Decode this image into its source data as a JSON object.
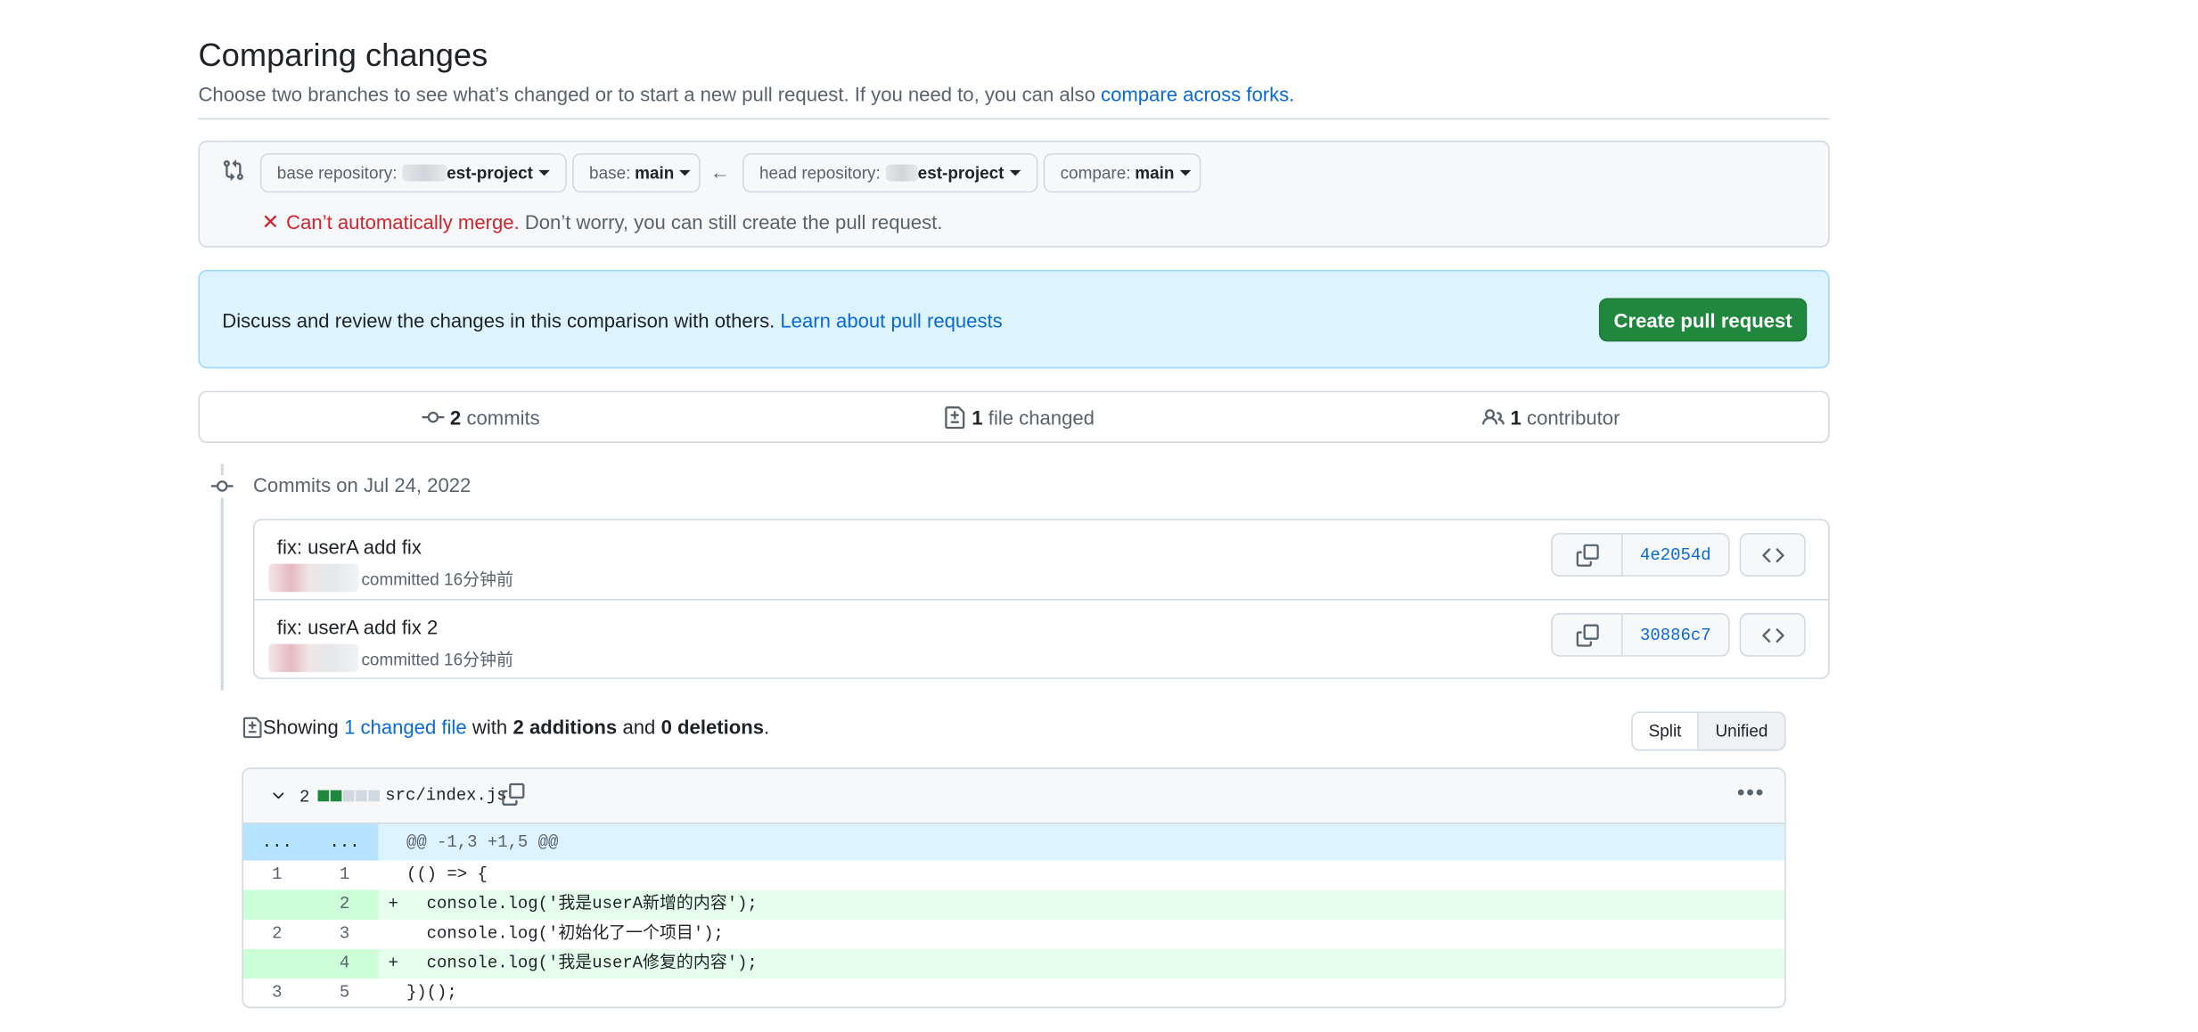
{
  "header": {
    "title": "Comparing changes",
    "subtitle": "Choose two branches to see what’s changed or to start a new pull request. If you need to, you can also",
    "subtitle_link": "compare across forks."
  },
  "range": {
    "base_repo_label": "base repository:",
    "base_repo_value": "est-project",
    "base_label": "base:",
    "base_value": "main",
    "head_repo_label": "head repository:",
    "head_repo_value": "est-project",
    "compare_label": "compare:",
    "compare_value": "main",
    "merge_status_bad": "Can’t automatically merge.",
    "merge_status_note": "Don’t worry, you can still create the pull request."
  },
  "blankslate": {
    "text": "Discuss and review the changes in this comparison with others.",
    "link": "Learn about pull requests",
    "button": "Create pull request"
  },
  "summary": {
    "commits_count": "2",
    "commits_label": "commits",
    "files_count": "1",
    "files_label": "file changed",
    "contributors_count": "1",
    "contributors_label": "contributor"
  },
  "timeline": {
    "date_heading": "Commits on Jul 24, 2022",
    "commits": [
      {
        "title": "fix: userA add fix",
        "meta": "committed 16分钟前",
        "sha": "4e2054d"
      },
      {
        "title": "fix: userA add fix 2",
        "meta": "committed 16分钟前",
        "sha": "30886c7"
      }
    ]
  },
  "toc": {
    "showing": "Showing",
    "changed_file": "1 changed file",
    "with": "with",
    "additions": "2 additions",
    "and": "and",
    "deletions": "0 deletions",
    "period": ".",
    "split": "Split",
    "unified": "Unified"
  },
  "file": {
    "additions_count": "2",
    "path": "src/index.js",
    "hunk_left": "...",
    "hunk_right": "...",
    "hunk_header": "@@ -1,3 +1,5 @@",
    "lines": [
      {
        "old": "1",
        "new": "1",
        "marker": "",
        "code": "(() => {"
      },
      {
        "old": "",
        "new": "2",
        "marker": "+",
        "code": "  console.log('我是userA新增的内容');"
      },
      {
        "old": "2",
        "new": "3",
        "marker": "",
        "code": "  console.log('初始化了一个项目');"
      },
      {
        "old": "",
        "new": "4",
        "marker": "+",
        "code": "  console.log('我是userA修复的内容');"
      },
      {
        "old": "3",
        "new": "5",
        "marker": "",
        "code": "})();"
      }
    ]
  },
  "colors": {
    "accent": "#0969da",
    "primary_button": "#1f883d",
    "danger": "#d1242f",
    "addition_bg": "#e6ffec",
    "hunk_bg": "#ddf4ff"
  }
}
